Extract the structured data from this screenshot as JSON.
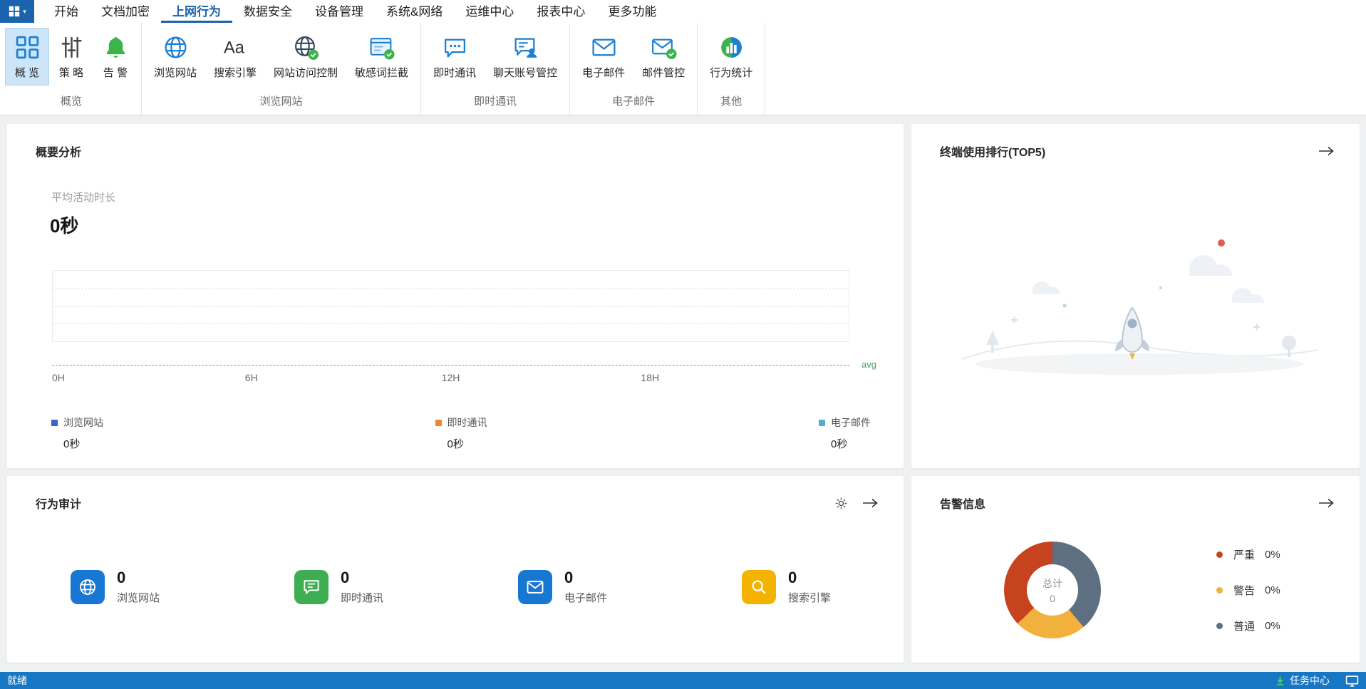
{
  "menubar": {
    "active_tab": "上网行为",
    "tabs": [
      {
        "label": "开始"
      },
      {
        "label": "文档加密"
      },
      {
        "label": "上网行为"
      },
      {
        "label": "数据安全"
      },
      {
        "label": "设备管理"
      },
      {
        "label": "系统&网络"
      },
      {
        "label": "运维中心"
      },
      {
        "label": "报表中心"
      },
      {
        "label": "更多功能"
      }
    ]
  },
  "ribbon": {
    "groups": [
      {
        "label": "概览",
        "buttons": [
          {
            "label": "概 览",
            "icon": "overview-grid-icon",
            "selected": true
          },
          {
            "label": "策 略",
            "icon": "sliders-icon",
            "selected": false
          },
          {
            "label": "告 警",
            "icon": "bell-icon",
            "selected": false
          }
        ]
      },
      {
        "label": "浏览网站",
        "buttons": [
          {
            "label": "浏览网站",
            "icon": "globe-icon"
          },
          {
            "label": "搜索引擎",
            "icon": "font-Aa-icon"
          },
          {
            "label": "网站访问控制",
            "icon": "globe-check-icon"
          },
          {
            "label": "敏感词拦截",
            "icon": "page-check-icon"
          }
        ]
      },
      {
        "label": "即时通讯",
        "buttons": [
          {
            "label": "即时通讯",
            "icon": "chat-icon"
          },
          {
            "label": "聊天账号管控",
            "icon": "chat-user-icon"
          }
        ]
      },
      {
        "label": "电子邮件",
        "buttons": [
          {
            "label": "电子邮件",
            "icon": "mail-icon"
          },
          {
            "label": "邮件管控",
            "icon": "mail-check-icon"
          }
        ]
      },
      {
        "label": "其他",
        "buttons": [
          {
            "label": "行为统计",
            "icon": "globe-stats-icon"
          }
        ]
      }
    ]
  },
  "summary_card": {
    "title": "概要分析",
    "metric_label": "平均活动时长",
    "metric_value": "0秒",
    "chart_data": {
      "type": "line",
      "x_ticks": [
        "0H",
        "6H",
        "12H",
        "18H"
      ],
      "x_range_hours": [
        0,
        24
      ],
      "grid": "dashed-horizontal",
      "avg_line": {
        "label": "avg",
        "value": 0,
        "color": "#57b26e"
      },
      "series": [
        {
          "name": "浏览网站",
          "color": "#3d63c9",
          "values": []
        },
        {
          "name": "即时通讯",
          "color": "#ee8a2e",
          "values": []
        },
        {
          "name": "电子邮件",
          "color": "#54aed1",
          "values": []
        }
      ]
    },
    "legend": [
      {
        "label": "浏览网站",
        "value": "0秒",
        "color": "#3d63c9"
      },
      {
        "label": "即时通讯",
        "value": "0秒",
        "color": "#ee8a2e"
      },
      {
        "label": "电子邮件",
        "value": "0秒",
        "color": "#54aed1"
      }
    ]
  },
  "top5_card": {
    "title": "终端使用排行(TOP5)"
  },
  "audit_card": {
    "title": "行为审计",
    "stats": [
      {
        "label": "浏览网站",
        "value": "0",
        "color": "#1777d2",
        "icon": "globe-icon"
      },
      {
        "label": "即时通讯",
        "value": "0",
        "color": "#3fae53",
        "icon": "chat-icon"
      },
      {
        "label": "电子邮件",
        "value": "0",
        "color": "#1777d2",
        "icon": "mail-icon"
      },
      {
        "label": "搜索引擎",
        "value": "0",
        "color": "#f5b301",
        "icon": "search-icon"
      }
    ]
  },
  "alarm_card": {
    "title": "告警信息",
    "center_label": "总计",
    "center_value": "0",
    "chart_data": {
      "type": "pie",
      "categories": [
        "严重",
        "警告",
        "普通"
      ],
      "values": [
        0,
        0,
        0
      ],
      "display_percents": [
        "0%",
        "0%",
        "0%"
      ],
      "colors": [
        "#c7431f",
        "#f2b13d",
        "#5e6f81"
      ],
      "center_label": "总计",
      "center_value": 0,
      "legend_position": "right"
    },
    "legend": [
      {
        "label": "严重",
        "value": "0%",
        "color": "#c7431f"
      },
      {
        "label": "警告",
        "value": "0%",
        "color": "#f2b13d"
      },
      {
        "label": "普通",
        "value": "0%",
        "color": "#5e6f81"
      }
    ]
  },
  "statusbar": {
    "ready": "就绪",
    "task_center": "任务中心"
  }
}
